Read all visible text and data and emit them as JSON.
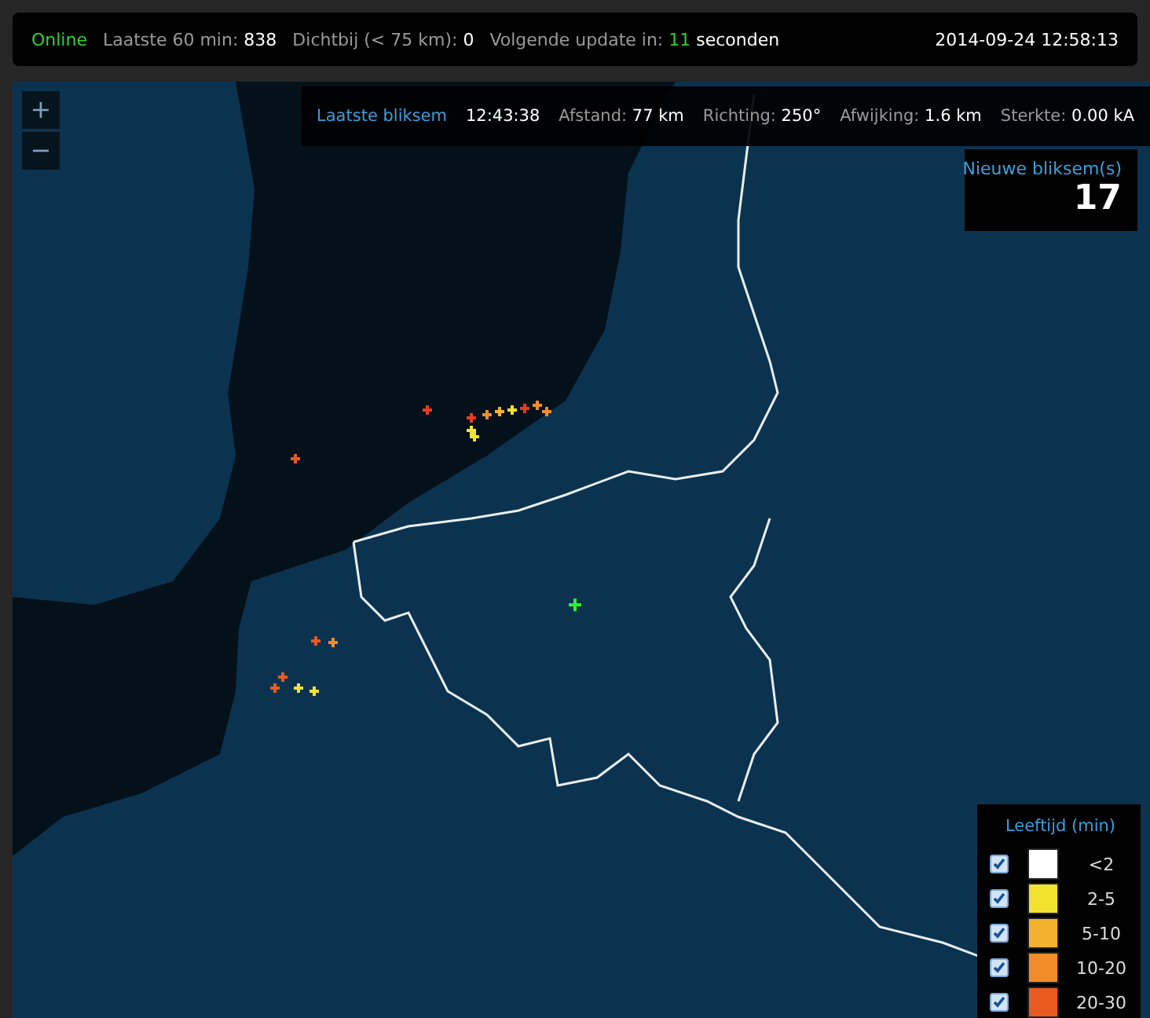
{
  "status_bar": {
    "state": "Online",
    "counters": [
      {
        "label": "Laatste 60 min:",
        "value": "838"
      },
      {
        "label": "Dichtbij (< 75 km):",
        "value": "0"
      }
    ],
    "update": {
      "label": "Volgende update in:",
      "value": "11",
      "unit": "seconden"
    },
    "datetime": "2014-09-24 12:58:13"
  },
  "zoom_controls": [
    "+",
    "−"
  ],
  "last_strike": {
    "title": "Laatste bliksem",
    "time": "12:43:38",
    "fields": [
      {
        "label": "Afstand:",
        "value": "77 km"
      },
      {
        "label": "Richting:",
        "value": "250°"
      },
      {
        "label": "Afwijking:",
        "value": "1.6 km"
      },
      {
        "label": "Sterkte:",
        "value": "0.00 kA"
      }
    ]
  },
  "new_strikes": {
    "label": "Nieuwe bliksem(s)",
    "count": "17"
  },
  "legend": {
    "title": "Leeftijd (min)",
    "items": [
      {
        "label": "<2",
        "color": "#ffffff",
        "checked": true
      },
      {
        "label": "2-5",
        "color": "#f2e230",
        "checked": true
      },
      {
        "label": "5-10",
        "color": "#f3b22e",
        "checked": true
      },
      {
        "label": "10-20",
        "color": "#f08c2a",
        "checked": true
      },
      {
        "label": "20-30",
        "color": "#e85a20",
        "checked": true
      }
    ]
  }
}
